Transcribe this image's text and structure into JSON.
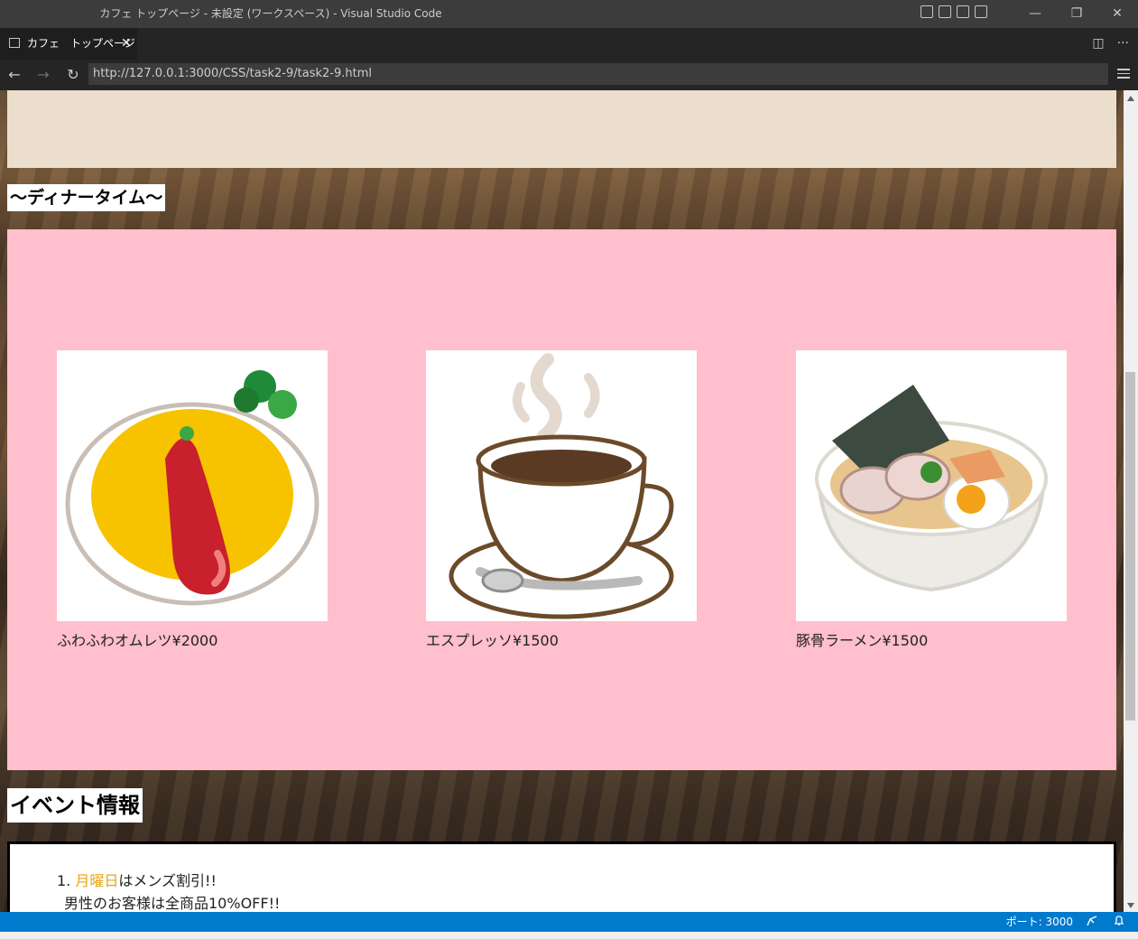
{
  "window": {
    "title": "カフェ トップページ - 未設定 (ワークスペース) - Visual Studio Code",
    "minimize": "—",
    "restore": "❐",
    "close": "✕"
  },
  "tab": {
    "label": "カフェ　トップページ",
    "close": "✕"
  },
  "tab_actions": {
    "split": "◫",
    "more": "···"
  },
  "nav": {
    "back": "←",
    "forward": "→",
    "reload": "↻",
    "url": "http://127.0.0.1:3000/CSS/task2-9/task2-9.html"
  },
  "page": {
    "dinner_heading": "〜ディナータイム〜",
    "menu_items": [
      {
        "caption": "ふわふわオムレツ¥2000",
        "icon": "omelette-image"
      },
      {
        "caption": "エスプレッソ¥1500",
        "icon": "coffee-cup-image"
      },
      {
        "caption": "豚骨ラーメン¥1500",
        "icon": "ramen-bowl-image"
      }
    ],
    "event_heading": "イベント情報",
    "events": [
      {
        "number": "1.",
        "highlight": "月曜日",
        "text": "はメンズ割引!!",
        "detail": "男性のお客様は全商品10%OFF!!"
      }
    ]
  },
  "status": {
    "port_label": "ポート: 3000"
  },
  "colors": {
    "pink_section": "#ffbfcc",
    "beige_section": "#ecdecc",
    "status_bar": "#007acc",
    "event_accent": "#e8a317"
  }
}
